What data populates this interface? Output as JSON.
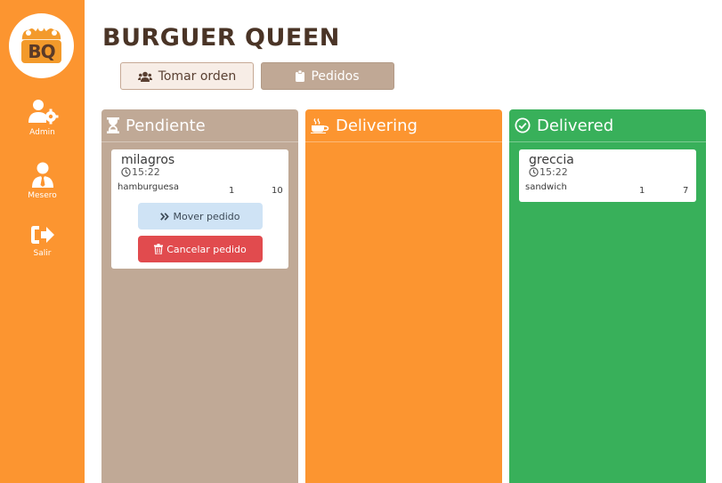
{
  "app": {
    "title": "BURGUER QUEEN",
    "logo_text": "BQ"
  },
  "sidebar": {
    "items": [
      {
        "label": "Admin",
        "icon": "user-gear-icon"
      },
      {
        "label": "Mesero",
        "icon": "user-tie-icon"
      },
      {
        "label": "Salir",
        "icon": "sign-out-icon"
      }
    ]
  },
  "tabs": [
    {
      "label": "Tomar orden",
      "icon": "users-icon",
      "active": false
    },
    {
      "label": "Pedidos",
      "icon": "clipboard-icon",
      "active": true
    }
  ],
  "columns": [
    {
      "title": "Pendiente",
      "icon": "hourglass-icon",
      "color": "#c0a996",
      "orders": [
        {
          "client": "milagros",
          "time": "15:22",
          "items": [
            {
              "name": "hamburguesa",
              "qty": "1",
              "price": "10"
            }
          ],
          "actions": {
            "move": "Mover pedido",
            "cancel": "Cancelar pedido"
          }
        }
      ]
    },
    {
      "title": "Delivering",
      "icon": "coffee-icon",
      "color": "#fc9530",
      "orders": []
    },
    {
      "title": "Delivered",
      "icon": "check-circle-icon",
      "color": "#38b05a",
      "orders": [
        {
          "client": "greccia",
          "time": "15:22",
          "items": [
            {
              "name": "sandwich",
              "qty": "1",
              "price": "7"
            }
          ]
        }
      ]
    }
  ],
  "colors": {
    "sidebar": "#fc9530",
    "title": "#4a3426",
    "cancel": "#e14b4e",
    "move": "#cfe3f5"
  }
}
